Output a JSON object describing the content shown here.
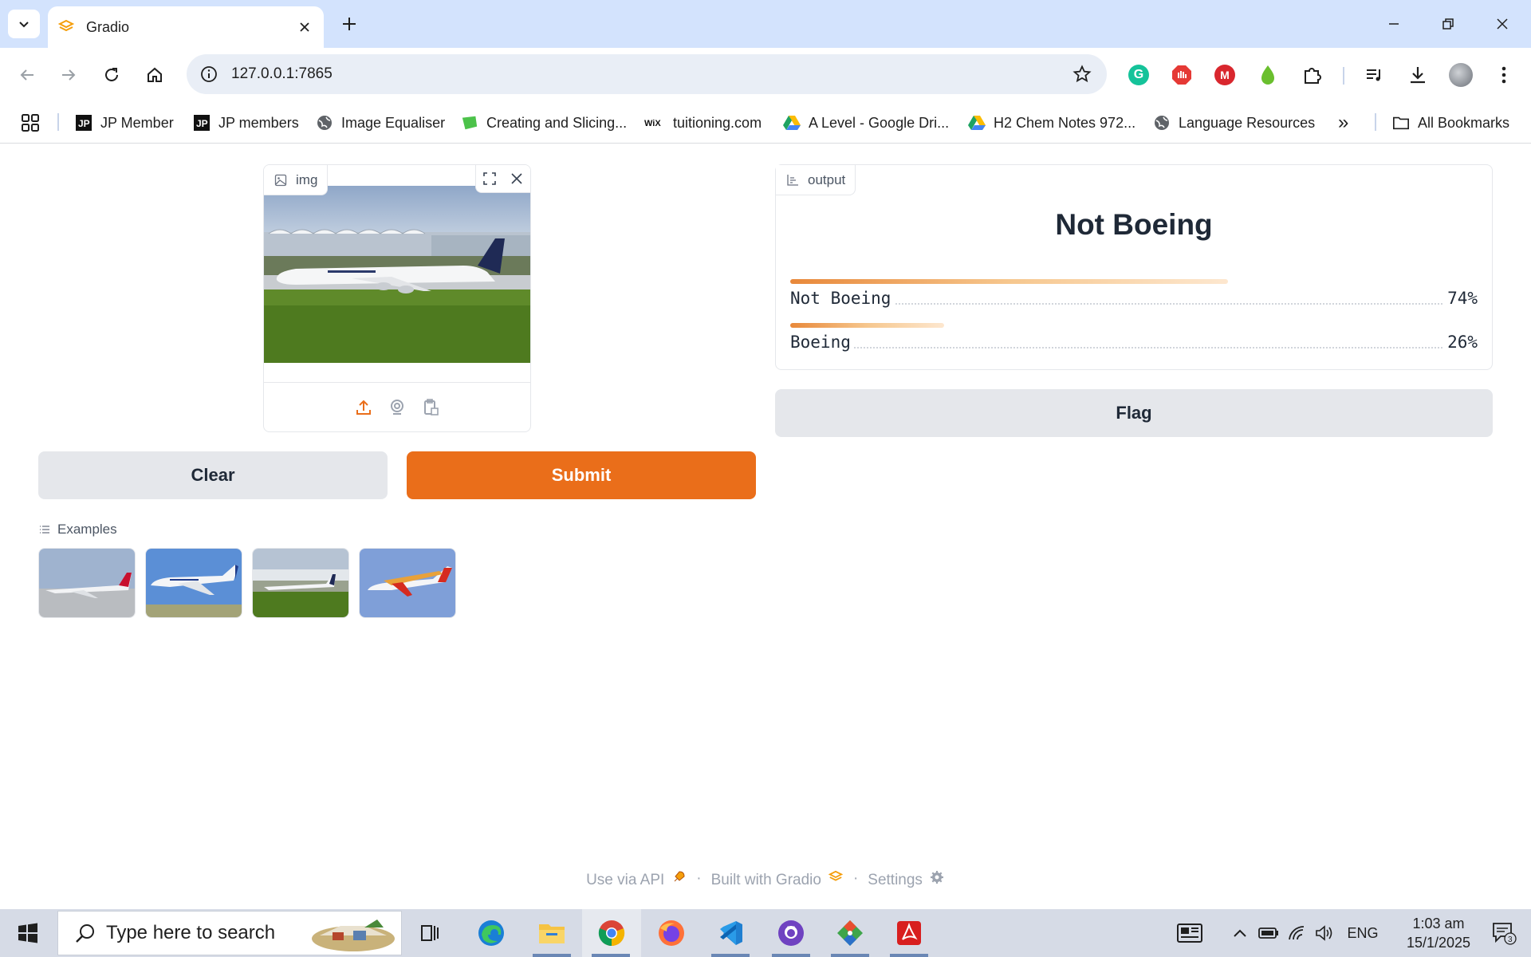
{
  "browser": {
    "tab_title": "Gradio",
    "url": "127.0.0.1:7865",
    "bookmarks": [
      {
        "label": "JP Member",
        "icon": "jp-icon"
      },
      {
        "label": "JP members",
        "icon": "jp-icon"
      },
      {
        "label": "Image Equaliser",
        "icon": "globe-icon"
      },
      {
        "label": "Creating and Slicing...",
        "icon": "leaf-icon"
      },
      {
        "label": "tuitioning.com",
        "icon": "wix-icon"
      },
      {
        "label": "A Level - Google Dri...",
        "icon": "drive-icon"
      },
      {
        "label": "H2 Chem Notes 972...",
        "icon": "drive-icon"
      },
      {
        "label": "Language Resources",
        "icon": "globe-icon"
      }
    ],
    "overflow_label": "»",
    "all_bookmarks_label": "All Bookmarks",
    "extensions": [
      "grammarly-icon",
      "adblock-icon",
      "mega-icon",
      "drop-icon",
      "puzzle-icon"
    ]
  },
  "app": {
    "input_label": "img",
    "clear_label": "Clear",
    "submit_label": "Submit",
    "examples_label": "Examples",
    "output_label": "output",
    "prediction": "Not Boeing",
    "confidences": [
      {
        "label": "Not Boeing",
        "value": "74%",
        "fraction": 0.74
      },
      {
        "label": "Boeing",
        "value": "26%",
        "fraction": 0.26
      }
    ],
    "flag_label": "Flag",
    "footer": {
      "api": "Use via API",
      "built": "Built with Gradio",
      "settings": "Settings"
    }
  },
  "colors": {
    "accent": "#ea6e1a",
    "tabbar": "#d3e3fd",
    "button_secondary": "#e5e7eb"
  },
  "taskbar": {
    "search_placeholder": "Type here to search",
    "apps": [
      "task-view-icon",
      "edge-icon",
      "file-explorer-icon",
      "chrome-icon",
      "firefox-icon",
      "vscode-icon",
      "github-desktop-icon",
      "git-icon",
      "acrobat-icon"
    ],
    "language": "ENG",
    "time": "1:03 am",
    "date": "15/1/2025",
    "notification_count": "3"
  }
}
